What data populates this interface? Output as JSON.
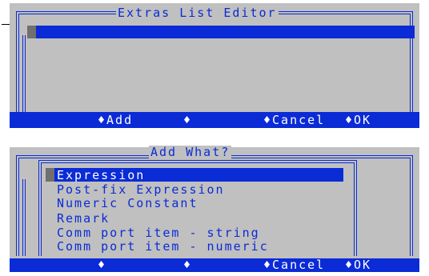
{
  "top_dialog": {
    "title": "Extras List Editor",
    "buttons": [
      {
        "label": "♦Add"
      },
      {
        "label": "♦"
      },
      {
        "label": "♦Cancel"
      },
      {
        "label": "♦OK"
      }
    ]
  },
  "bottom_dialog": {
    "title": "Add What?",
    "items": [
      {
        "label": "Expression",
        "selected": true
      },
      {
        "label": "Post-fix Expression",
        "selected": false
      },
      {
        "label": "Numeric Constant",
        "selected": false
      },
      {
        "label": "Remark",
        "selected": false
      },
      {
        "label": "Comm port item - string",
        "selected": false
      },
      {
        "label": "Comm port item - numeric",
        "selected": false
      }
    ],
    "buttons": [
      {
        "label": "♦"
      },
      {
        "label": "♦"
      },
      {
        "label": "♦Cancel"
      },
      {
        "label": "♦OK"
      }
    ]
  },
  "colors": {
    "frame_blue": "#0a2bd6",
    "panel_gray": "#c0c0c0",
    "cursor_gray": "#707070",
    "text_white": "#ffffff"
  }
}
